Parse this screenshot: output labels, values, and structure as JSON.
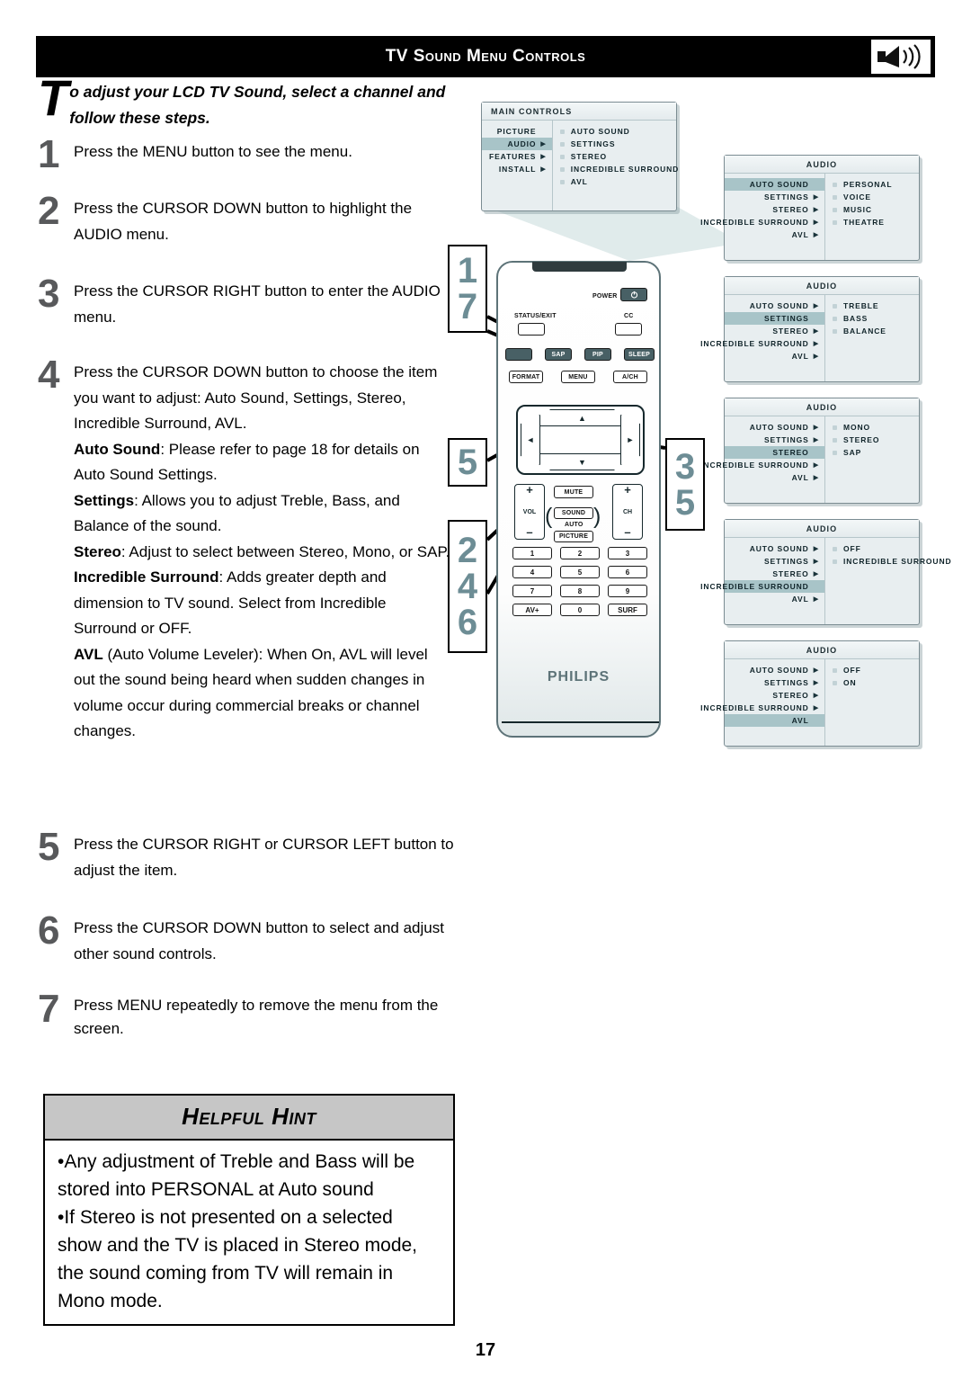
{
  "header": {
    "title": "TV Sound Menu Controls",
    "icon": "speaker-volume-icon"
  },
  "intro": {
    "dropcap": "T",
    "text": "o adjust your LCD TV Sound, select a channel and follow these steps."
  },
  "steps": [
    {
      "num": "1",
      "text": "Press the MENU button to see the menu."
    },
    {
      "num": "2",
      "text": "Press the CURSOR DOWN button to highlight the AUDIO menu."
    },
    {
      "num": "3",
      "text": "Press the CURSOR RIGHT button to enter the AUDIO menu."
    },
    {
      "num": "4",
      "text": "Press the CURSOR DOWN button to choose the item you want to adjust: Auto Sound, Settings, Stereo, Incredible Surround, AVL."
    },
    {
      "num": "5",
      "text": "Press the CURSOR RIGHT or CURSOR LEFT button to adjust the item."
    },
    {
      "num": "6",
      "text": "Press the CURSOR DOWN button to select and adjust other sound controls."
    },
    {
      "num": "7",
      "text": "Press MENU repeatedly to remove the menu from the screen."
    }
  ],
  "step4_definitions": [
    {
      "term": "Auto Sound",
      "desc": ": Please refer to page 18 for details on Auto Sound Settings."
    },
    {
      "term": "Settings",
      "desc": ": Allows you to adjust Treble, Bass, and Balance of the sound."
    },
    {
      "term": "Stereo",
      "desc": ": Adjust to select between Stereo, Mono, or SAP."
    },
    {
      "term": "Incredible Surround",
      "desc": ": Adds greater depth and dimension to TV sound. Select from Incredible Surround or OFF."
    },
    {
      "term": "AVL",
      "desc": " (Auto Volume Leveler): When On, AVL will level out the sound being heard when sudden changes in volume occur during commercial breaks or channel changes."
    }
  ],
  "hint": {
    "title": "Helpful Hint",
    "items": [
      "•Any adjustment of Treble and Bass will be stored into PERSONAL at Auto sound",
      "•If Stereo is not presented on a selected show and the TV is placed in Stereo mode, the sound coming from TV will remain in Mono mode."
    ]
  },
  "osd": {
    "main_controls": {
      "title": "MAIN CONTROLS",
      "left_items": [
        {
          "label": "PICTURE",
          "arrow": false,
          "selected": false
        },
        {
          "label": "AUDIO",
          "arrow": true,
          "selected": true
        },
        {
          "label": "FEATURES",
          "arrow": true,
          "selected": false
        },
        {
          "label": "INSTALL",
          "arrow": true,
          "selected": false
        }
      ],
      "right_items": [
        "AUTO SOUND",
        "SETTINGS",
        "STEREO",
        "INCREDIBLE SURROUND",
        "AVL"
      ]
    },
    "audio_panels": [
      {
        "title": "AUDIO",
        "left_items": [
          {
            "label": "AUTO SOUND",
            "arrow": false,
            "selected": true
          },
          {
            "label": "SETTINGS",
            "arrow": true,
            "selected": false
          },
          {
            "label": "STEREO",
            "arrow": true,
            "selected": false
          },
          {
            "label": "INCREDIBLE SURROUND",
            "arrow": true,
            "selected": false
          },
          {
            "label": "AVL",
            "arrow": true,
            "selected": false
          }
        ],
        "right_items": [
          "PERSONAL",
          "VOICE",
          "MUSIC",
          "THEATRE"
        ]
      },
      {
        "title": "AUDIO",
        "left_items": [
          {
            "label": "AUTO SOUND",
            "arrow": true,
            "selected": false
          },
          {
            "label": "SETTINGS",
            "arrow": false,
            "selected": true
          },
          {
            "label": "STEREO",
            "arrow": true,
            "selected": false
          },
          {
            "label": "INCREDIBLE SURROUND",
            "arrow": true,
            "selected": false
          },
          {
            "label": "AVL",
            "arrow": true,
            "selected": false
          }
        ],
        "right_items": [
          "TREBLE",
          "BASS",
          "BALANCE"
        ]
      },
      {
        "title": "AUDIO",
        "left_items": [
          {
            "label": "AUTO SOUND",
            "arrow": true,
            "selected": false
          },
          {
            "label": "SETTINGS",
            "arrow": true,
            "selected": false
          },
          {
            "label": "STEREO",
            "arrow": false,
            "selected": true
          },
          {
            "label": "INCREDIBLE SURROUND",
            "arrow": true,
            "selected": false
          },
          {
            "label": "AVL",
            "arrow": true,
            "selected": false
          }
        ],
        "right_items": [
          "MONO",
          "STEREO",
          "SAP"
        ]
      },
      {
        "title": "AUDIO",
        "left_items": [
          {
            "label": "AUTO SOUND",
            "arrow": true,
            "selected": false
          },
          {
            "label": "SETTINGS",
            "arrow": true,
            "selected": false
          },
          {
            "label": "STEREO",
            "arrow": true,
            "selected": false
          },
          {
            "label": "INCREDIBLE SURROUND",
            "arrow": false,
            "selected": true
          },
          {
            "label": "AVL",
            "arrow": true,
            "selected": false
          }
        ],
        "right_items": [
          "OFF",
          "INCREDIBLE SURROUND"
        ]
      },
      {
        "title": "AUDIO",
        "left_items": [
          {
            "label": "AUTO SOUND",
            "arrow": true,
            "selected": false
          },
          {
            "label": "SETTINGS",
            "arrow": true,
            "selected": false
          },
          {
            "label": "STEREO",
            "arrow": true,
            "selected": false
          },
          {
            "label": "INCREDIBLE SURROUND",
            "arrow": true,
            "selected": false
          },
          {
            "label": "AVL",
            "arrow": false,
            "selected": true
          }
        ],
        "right_items": [
          "OFF",
          "ON"
        ]
      }
    ]
  },
  "remote": {
    "brand": "PHILIPS",
    "power_label": "POWER",
    "status_label": "STATUS/EXIT",
    "cc_label": "CC",
    "row_sap": [
      "SAP",
      "PIP",
      "SLEEP"
    ],
    "row_format": [
      "FORMAT",
      "MENU",
      "A/CH"
    ],
    "mute": "MUTE",
    "sound": "SOUND",
    "auto": "AUTO",
    "picture": "PICTURE",
    "vol": "VOL",
    "ch": "CH",
    "plus": "+",
    "minus": "–",
    "keys": [
      [
        "1",
        "2",
        "3"
      ],
      [
        "4",
        "5",
        "6"
      ],
      [
        "7",
        "8",
        "9"
      ],
      [
        "AV+",
        "0",
        "SURF"
      ]
    ]
  },
  "callouts": {
    "top_left": [
      "1",
      "7"
    ],
    "mid_left": [
      "5"
    ],
    "bottom_left": [
      "2",
      "4",
      "6"
    ],
    "right": [
      "3",
      "5"
    ]
  },
  "page_number": "17",
  "colors": {
    "callout_number": "#6d8d95",
    "step_number": "#58595b",
    "osd_background": "#e8eef0",
    "osd_highlight": "#a8c4c8",
    "hint_header": "#c6c6c6",
    "header_bar": "#000000"
  }
}
